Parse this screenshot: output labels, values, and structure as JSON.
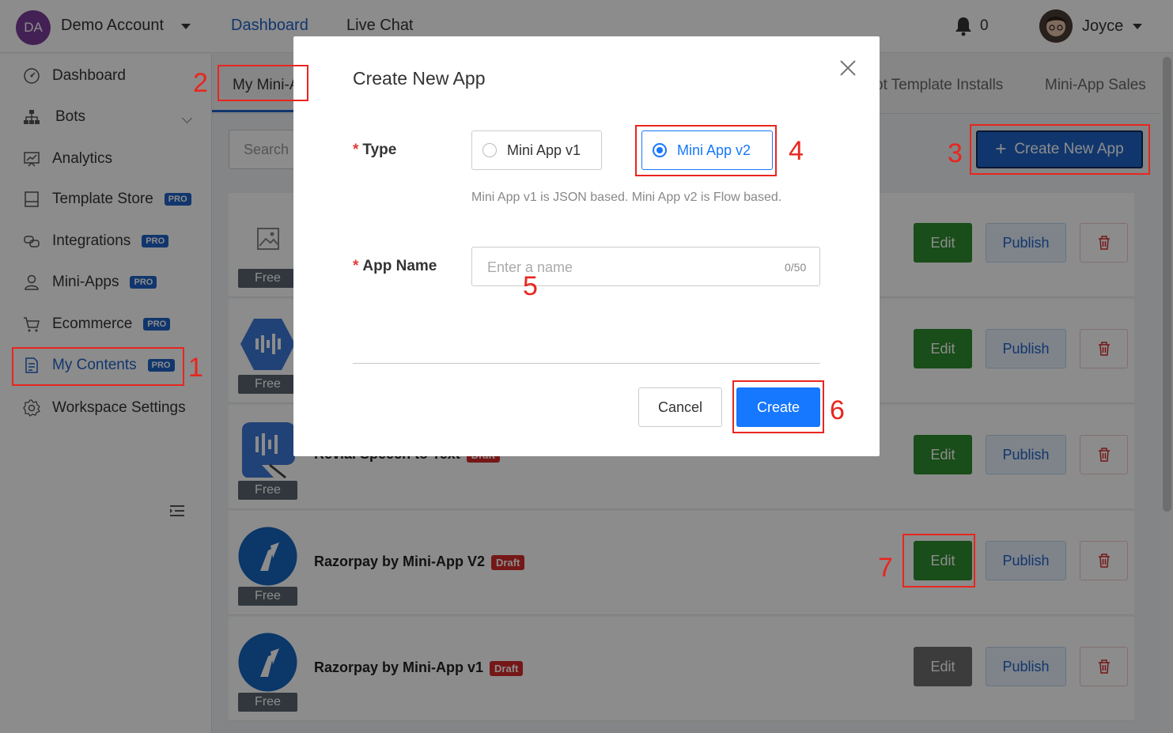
{
  "topbar": {
    "workspace_initials": "DA",
    "workspace_name": "Demo Account",
    "nav": [
      "Dashboard",
      "Live Chat"
    ],
    "notification_count": "0",
    "user_name": "Joyce"
  },
  "sidebar": {
    "items": [
      {
        "label": "Dashboard",
        "pro": ""
      },
      {
        "label": "Bots",
        "pro": ""
      },
      {
        "label": "Analytics",
        "pro": ""
      },
      {
        "label": "Template Store",
        "pro": "PRO"
      },
      {
        "label": "Integrations",
        "pro": "PRO"
      },
      {
        "label": "Mini-Apps",
        "pro": "PRO"
      },
      {
        "label": "Ecommerce",
        "pro": "PRO"
      },
      {
        "label": "My Contents",
        "pro": "PRO"
      },
      {
        "label": "Workspace Settings",
        "pro": ""
      }
    ]
  },
  "main": {
    "tabs": [
      "My Mini-A",
      "ot Template Installs",
      "Mini-App Sales"
    ],
    "search_placeholder": "Search",
    "create_button": "Create New App",
    "cards": [
      {
        "title": "",
        "draft": "",
        "badge": "Free",
        "edit": "Edit",
        "publish": "Publish"
      },
      {
        "title": "",
        "draft": "",
        "badge": "Free",
        "edit": "Edit",
        "publish": "Publish"
      },
      {
        "title": "Revial Speech to Text",
        "draft": "Draft",
        "badge": "Free",
        "edit": "Edit",
        "publish": "Publish"
      },
      {
        "title": "Razorpay by Mini-App V2",
        "draft": "Draft",
        "badge": "Free",
        "edit": "Edit",
        "publish": "Publish"
      },
      {
        "title": "Razorpay by Mini-App v1",
        "draft": "Draft",
        "badge": "Free",
        "edit": "Edit",
        "publish": "Publish"
      }
    ]
  },
  "modal": {
    "title": "Create New App",
    "type_label": "Type",
    "option_v1": "Mini App v1",
    "option_v2": "Mini App v2",
    "selected": "Mini App v2",
    "hint": "Mini App v1 is JSON based. Mini App v2 is Flow based.",
    "name_label": "App Name",
    "name_placeholder": "Enter a name",
    "name_counter": "0/50",
    "cancel": "Cancel",
    "create": "Create"
  },
  "annotations": [
    "1",
    "2",
    "3",
    "4",
    "5",
    "6",
    "7"
  ],
  "colors": {
    "accent": "#1f63c7",
    "modal_primary": "#1677ff",
    "edit_green": "#2f8c2f",
    "draft_red": "#d62b2b",
    "annotation_red": "#e8261f"
  }
}
